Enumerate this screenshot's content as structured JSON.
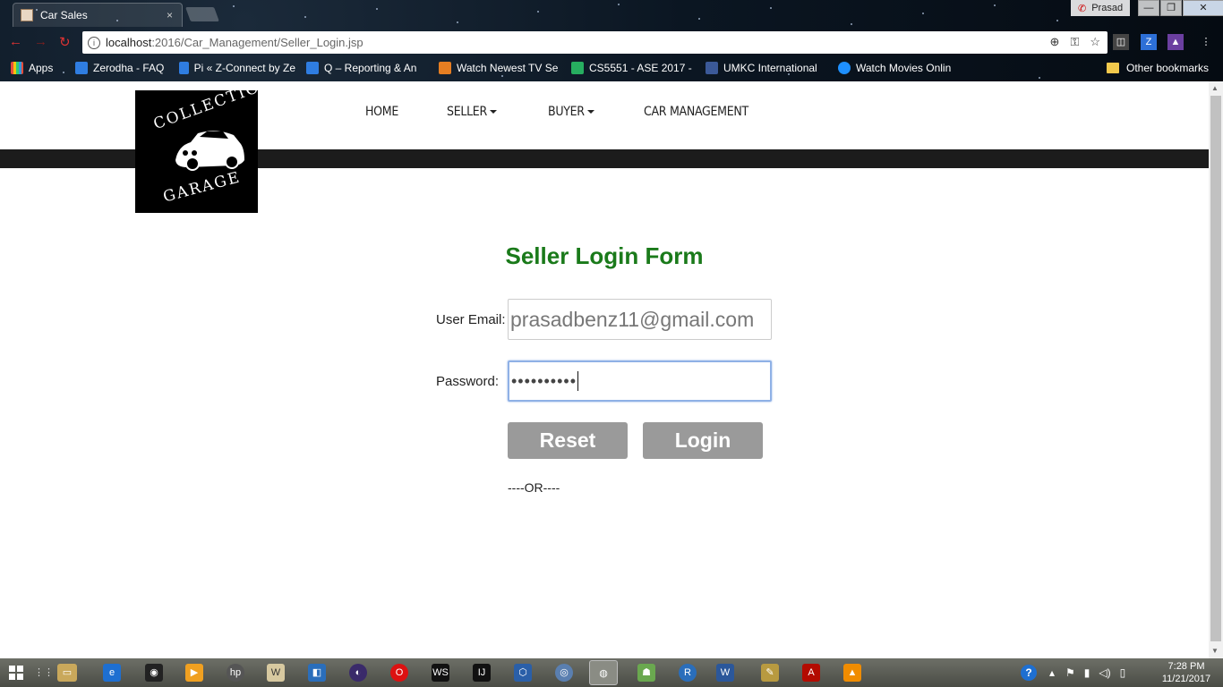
{
  "browser": {
    "tab_title": "Car Sales",
    "tab_close": "×",
    "profile_name": "Prasad",
    "url_host": "localhost",
    "url_path": ":2016/Car_Management/Seller_Login.jsp",
    "window_buttons": [
      "—",
      "❐",
      "✕"
    ],
    "bookmarks": [
      {
        "label": "Apps",
        "color": "#e74c3c"
      },
      {
        "label": "Zerodha - FAQ",
        "color": "#2f7de1"
      },
      {
        "label": "Pi « Z-Connect by Ze",
        "color": "#2f7de1"
      },
      {
        "label": "Q – Reporting & An",
        "color": "#2f7de1"
      },
      {
        "label": "Watch Newest TV Se",
        "color": "#e67e22"
      },
      {
        "label": "CS5551 - ASE 2017 -",
        "color": "#27ae60"
      },
      {
        "label": "UMKC International",
        "color": "#3b5998"
      },
      {
        "label": "Watch Movies Onlin",
        "color": "#1e90ff"
      }
    ],
    "other_bookmarks": "Other bookmarks"
  },
  "site": {
    "logo_top": "COLLECTION",
    "logo_bottom": "GARAGE",
    "nav": {
      "home": "HOME",
      "seller": "SELLER",
      "buyer": "BUYER",
      "car_management": "CAR MANAGEMENT"
    }
  },
  "form": {
    "title": "Seller Login Form",
    "email_label": "User Email:",
    "email_value": "prasadbenz11@gmail.com",
    "password_label": "Password:",
    "password_masked": "••••••••••",
    "reset_label": "Reset",
    "login_label": "Login",
    "or_text": "----OR----"
  },
  "taskbar": {
    "time": "7:28 PM",
    "date": "11/21/2017"
  },
  "colors": {
    "title_green": "#1a7a1a",
    "button_gray": "#9a9a9a",
    "dark_bar": "#1c1c1c"
  }
}
